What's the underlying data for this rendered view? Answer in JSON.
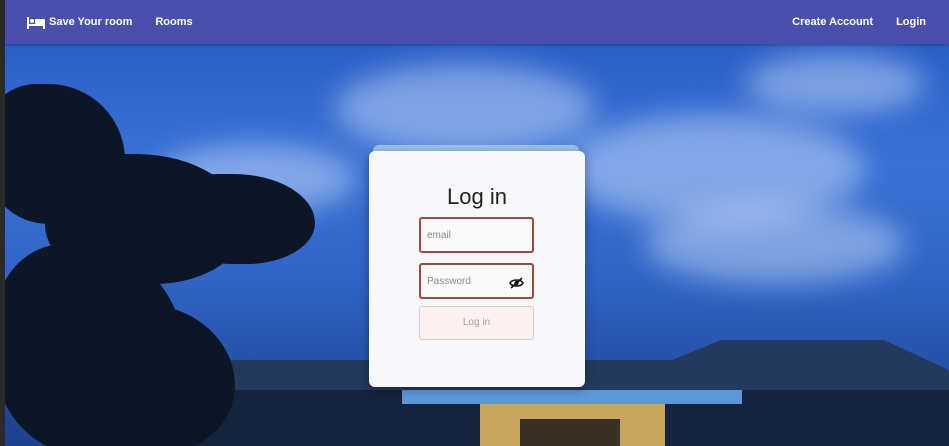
{
  "navbar": {
    "brand_icon": "bed-icon",
    "brand_label": "Save Your room",
    "rooms_label": "Rooms",
    "create_account_label": "Create Account",
    "login_label": "Login",
    "background_color": "#4a4fae"
  },
  "login_card": {
    "title": "Log in",
    "email": {
      "placeholder": "email",
      "value": ""
    },
    "password": {
      "placeholder": "Password",
      "value": "",
      "toggle_icon": "eye-off-icon"
    },
    "submit_label": "Log in",
    "field_border_color": "#a5473f"
  }
}
